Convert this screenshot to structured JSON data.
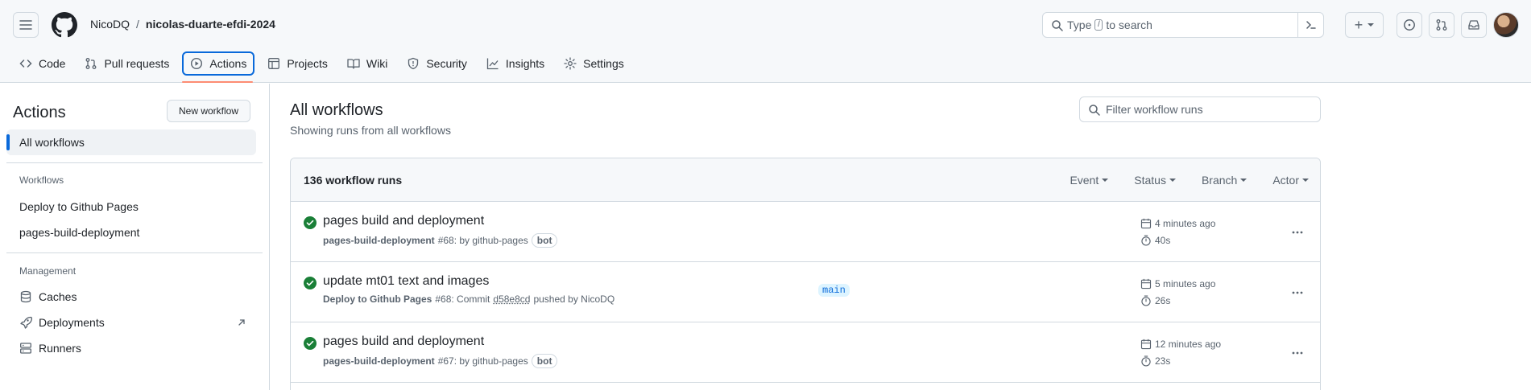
{
  "header": {
    "owner": "NicoDQ",
    "separator": "/",
    "repo": "nicolas-duarte-efdi-2024",
    "search_prefix": "Type",
    "search_key": "/",
    "search_suffix": "to search",
    "plus_label": "+"
  },
  "tabs": [
    {
      "label": "Code",
      "icon": "code-icon"
    },
    {
      "label": "Pull requests",
      "icon": "git-pull-request-icon"
    },
    {
      "label": "Actions",
      "icon": "play-icon"
    },
    {
      "label": "Projects",
      "icon": "table-icon"
    },
    {
      "label": "Wiki",
      "icon": "book-icon"
    },
    {
      "label": "Security",
      "icon": "shield-icon"
    },
    {
      "label": "Insights",
      "icon": "graph-icon"
    },
    {
      "label": "Settings",
      "icon": "gear-icon"
    }
  ],
  "sidebar": {
    "title": "Actions",
    "new_workflow": "New workflow",
    "all_workflows": "All workflows",
    "workflows_heading": "Workflows",
    "workflows": [
      "Deploy to Github Pages",
      "pages-build-deployment"
    ],
    "management_heading": "Management",
    "management": [
      {
        "label": "Caches",
        "icon": "database-icon"
      },
      {
        "label": "Deployments",
        "icon": "rocket-icon"
      },
      {
        "label": "Runners",
        "icon": "server-icon"
      }
    ]
  },
  "main": {
    "title": "All workflows",
    "subtitle": "Showing runs from all workflows",
    "filter_placeholder": "Filter workflow runs",
    "count": "136 workflow runs",
    "filters": [
      "Event",
      "Status",
      "Branch",
      "Actor"
    ],
    "runs": [
      {
        "title": "pages build and deployment",
        "workflow": "pages-build-deployment",
        "number": "#68",
        "by_text": ": by github-pages",
        "badge": "bot",
        "when": "4 minutes ago",
        "duration": "40s"
      },
      {
        "title": "update mt01 text and images",
        "workflow": "Deploy to Github Pages",
        "number": "#68",
        "commit_text": ": Commit",
        "sha": "d58e8cd",
        "pushed_text": "pushed by NicoDQ",
        "branch": "main",
        "when": "5 minutes ago",
        "duration": "26s"
      },
      {
        "title": "pages build and deployment",
        "workflow": "pages-build-deployment",
        "number": "#67",
        "by_text": ": by github-pages",
        "badge": "bot",
        "when": "12 minutes ago",
        "duration": "23s"
      }
    ]
  },
  "colors": {
    "accent": "#0969da",
    "success": "#1a7f37",
    "underline": "#fd8c73"
  }
}
